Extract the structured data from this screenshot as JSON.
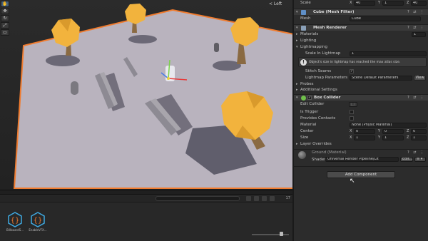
{
  "scene": {
    "perspective_label": "< Left",
    "tools": [
      "hand-icon",
      "move-icon",
      "rotate-icon",
      "scale-icon",
      "rect-icon"
    ],
    "colors": {
      "ground": "#b9b3be",
      "foliage": "#f2b33d",
      "trunk": "#8a6a42",
      "selection": "#f07b2e"
    }
  },
  "bottom": {
    "hidden_count": "17",
    "assets": [
      {
        "icon": "script-asset-icon",
        "label": "BillboardS..."
      },
      {
        "icon": "script-asset-icon",
        "label": "EnableVFX..."
      }
    ]
  },
  "inspector": {
    "scale": {
      "label": "Scale",
      "x": "40",
      "y": "1",
      "z": "40"
    },
    "mesh_filter": {
      "title": "Cube (Mesh Filter)",
      "mesh_label": "Mesh",
      "mesh_value": "Cube"
    },
    "mesh_renderer": {
      "title": "Mesh Renderer",
      "materials_label": "Materials",
      "materials_count": "1",
      "lighting_label": "Lighting",
      "lightmapping_label": "Lightmapping",
      "scale_in_lightmap_label": "Scale In Lightmap",
      "scale_in_lightmap_value": "1",
      "warning": "Object's size in lightmap has reached the max atlas size.",
      "stitch_seams_label": "Stitch Seams",
      "lightmap_params_label": "Lightmap Parameters",
      "lightmap_params_value": "Scene Default Parameters",
      "view_label": "View",
      "probes_label": "Probes",
      "additional_settings_label": "Additional Settings"
    },
    "box_collider": {
      "title": "Box Collider",
      "edit_collider_label": "Edit Collider",
      "is_trigger_label": "Is Trigger",
      "provides_contacts_label": "Provides Contacts",
      "material_label": "Material",
      "material_value": "None (Physic Material)",
      "center_label": "Center",
      "center": {
        "x": "0",
        "y": "0",
        "z": "0"
      },
      "size_label": "Size",
      "size": {
        "x": "1",
        "y": "1",
        "z": "1"
      },
      "layer_overrides_label": "Layer Overrides"
    },
    "material": {
      "title": "Ground (Material)",
      "shader_label": "Shader",
      "shader_value": "Universal Render Pipeline/Lit",
      "edit_label": "Edit..."
    },
    "add_component_label": "Add Component"
  }
}
